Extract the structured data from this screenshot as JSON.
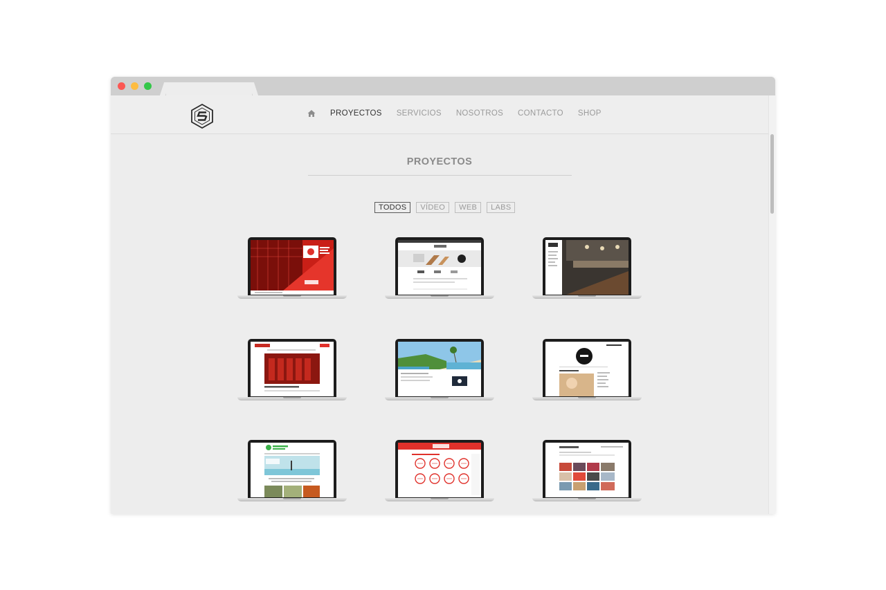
{
  "nav": {
    "items": [
      {
        "label": "PROYECTOS",
        "active": true
      },
      {
        "label": "SERVICIOS",
        "active": false
      },
      {
        "label": "NOSOTROS",
        "active": false
      },
      {
        "label": "CONTACTO",
        "active": false
      },
      {
        "label": "SHOP",
        "active": false
      }
    ]
  },
  "section": {
    "title": "PROYECTOS"
  },
  "filters": [
    {
      "label": "TODOS",
      "active": true
    },
    {
      "label": "VÍDEO",
      "active": false
    },
    {
      "label": "WEB",
      "active": false
    },
    {
      "label": "LABS",
      "active": false
    }
  ],
  "projects": [
    {
      "theme": "red-hall"
    },
    {
      "theme": "product-white"
    },
    {
      "theme": "dark-restaurant"
    },
    {
      "theme": "red-doors"
    },
    {
      "theme": "golf-beach"
    },
    {
      "theme": "black-circle"
    },
    {
      "theme": "green-sky"
    },
    {
      "theme": "red-circles"
    },
    {
      "theme": "photo-grid"
    }
  ],
  "colors": {
    "accent_red": "#e0312b",
    "nav_active": "#333333",
    "nav_inactive": "#9a9a9a",
    "background": "#ededed"
  },
  "icons": {
    "logo": "hexagon-s-logo-icon",
    "home": "home-icon"
  }
}
